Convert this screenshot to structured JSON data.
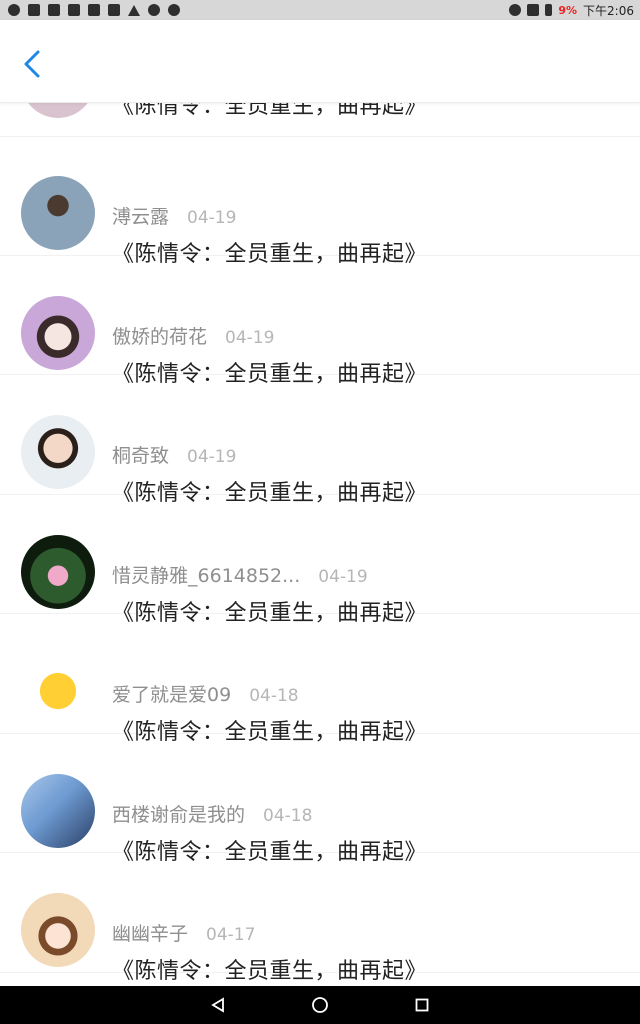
{
  "status_bar": {
    "battery_percent": "9%",
    "time": "下午2:06"
  },
  "header": {
    "back_icon": "back-chevron-icon"
  },
  "partial_row": {
    "title": "《陈情令：全员重生，曲再起》"
  },
  "items": [
    {
      "name": "溥云露",
      "date": "04-19",
      "title": "《陈情令：全员重生，曲再起》",
      "avatar_color": "#8aa3b8"
    },
    {
      "name": "傲娇的荷花",
      "date": "04-19",
      "title": "《陈情令：全员重生，曲再起》",
      "avatar_color": "#c9a7d8"
    },
    {
      "name": "桐奇致",
      "date": "04-19",
      "title": "《陈情令：全员重生，曲再起》",
      "avatar_color": "#e9dad2"
    },
    {
      "name": "惜灵静雅_6614852...",
      "date": "04-19",
      "title": "《陈情令：全员重生，曲再起》",
      "avatar_color": "#1f3a1f"
    },
    {
      "name": "爱了就是爱09",
      "date": "04-18",
      "title": "《陈情令：全员重生，曲再起》",
      "avatar_color": "#ffffff"
    },
    {
      "name": "西楼谢俞是我的",
      "date": "04-18",
      "title": "《陈情令：全员重生，曲再起》",
      "avatar_color": "#6d9ad1"
    },
    {
      "name": "幽幽辛子",
      "date": "04-17",
      "title": "《陈情令：全员重生，曲再起》",
      "avatar_color": "#f2d9b8"
    }
  ],
  "colors": {
    "accent": "#1e88e5",
    "status_bar_bg": "#d7d7d7",
    "nav_bar_bg": "#000000"
  }
}
